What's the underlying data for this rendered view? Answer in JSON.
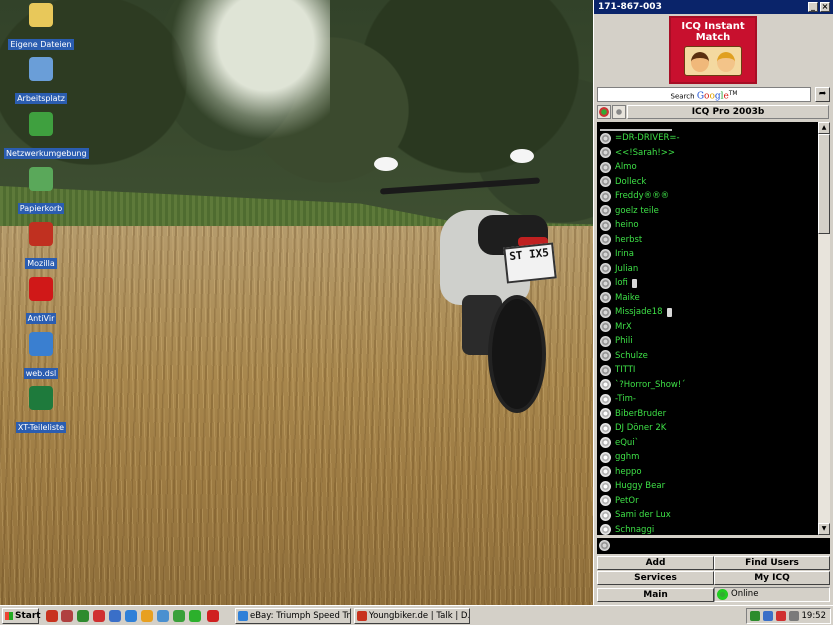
{
  "desktop": {
    "icons": [
      {
        "label": "Eigene Dateien",
        "icon": "folder-icon",
        "color": "#e8c85a"
      },
      {
        "label": "Arbeitsplatz",
        "icon": "computer-icon",
        "color": "#6a9ed8"
      },
      {
        "label": "Netzwerkumgebung",
        "icon": "network-icon",
        "color": "#3fa03f"
      },
      {
        "label": "Papierkorb",
        "icon": "recycle-bin-icon",
        "color": "#5aa85a"
      },
      {
        "label": "Mozilla",
        "icon": "mozilla-icon",
        "color": "#c03020"
      },
      {
        "label": "AntiVir",
        "icon": "antivir-icon",
        "color": "#d01818"
      },
      {
        "label": "web.dsl",
        "icon": "web-shortcut-icon",
        "color": "#3a7fd0"
      },
      {
        "label": "XT-Teileliste",
        "icon": "excel-icon",
        "color": "#1e7a3c"
      }
    ],
    "wallpaper_plate": "ST IX5"
  },
  "icq": {
    "title": "171-867-003",
    "banner": {
      "line1": "ICQ Instant",
      "line2": "Match"
    },
    "search_label": "Search",
    "search_brand": "Google",
    "search_tm": "TM",
    "header_title": "ICQ Pro 2003b",
    "contacts": [
      {
        "name": "=DR-DRIVER=-",
        "status": "online"
      },
      {
        "name": "<<!Sarah!>>",
        "status": "online"
      },
      {
        "name": "Almo",
        "status": "online"
      },
      {
        "name": "Dolleck",
        "status": "online"
      },
      {
        "name": "Freddy®®®",
        "status": "online"
      },
      {
        "name": "goelz teile",
        "status": "online"
      },
      {
        "name": "heino",
        "status": "online"
      },
      {
        "name": "herbst",
        "status": "online"
      },
      {
        "name": "Irina",
        "status": "online"
      },
      {
        "name": "Julian",
        "status": "online"
      },
      {
        "name": "lofi",
        "status": "online",
        "phone": true
      },
      {
        "name": "Maike",
        "status": "online"
      },
      {
        "name": "Missjade18",
        "status": "online",
        "phone": true
      },
      {
        "name": "MrX",
        "status": "online"
      },
      {
        "name": "Phili",
        "status": "online"
      },
      {
        "name": "Schulze",
        "status": "online"
      },
      {
        "name": "TITTI",
        "status": "online"
      },
      {
        "name": "`?Horror_Show!´",
        "status": "offline"
      },
      {
        "name": "-Tim-",
        "status": "offline"
      },
      {
        "name": "BiberBruder",
        "status": "offline"
      },
      {
        "name": "DJ Döner 2K",
        "status": "offline"
      },
      {
        "name": "eQui`",
        "status": "offline"
      },
      {
        "name": "gghm",
        "status": "offline"
      },
      {
        "name": "heppo",
        "status": "offline"
      },
      {
        "name": "Huggy Bear",
        "status": "offline"
      },
      {
        "name": "PetOr",
        "status": "offline"
      },
      {
        "name": "Sami der Lux",
        "status": "offline"
      },
      {
        "name": "Schnaggi",
        "status": "offline"
      }
    ],
    "buttons": {
      "add": "Add",
      "find_users": "Find Users",
      "services": "Services",
      "my_icq": "My ICQ",
      "main": "Main",
      "status": "Online"
    },
    "contact_color": "#3ee047"
  },
  "taskbar": {
    "start_label": "Start",
    "tasks": [
      {
        "label": "eBay: Triumph Speed Tri...",
        "icon": "ie-icon"
      },
      {
        "label": "Youngbiker.de | Talk | D...",
        "icon": "mozilla-icon"
      }
    ],
    "clock": "19:52"
  }
}
